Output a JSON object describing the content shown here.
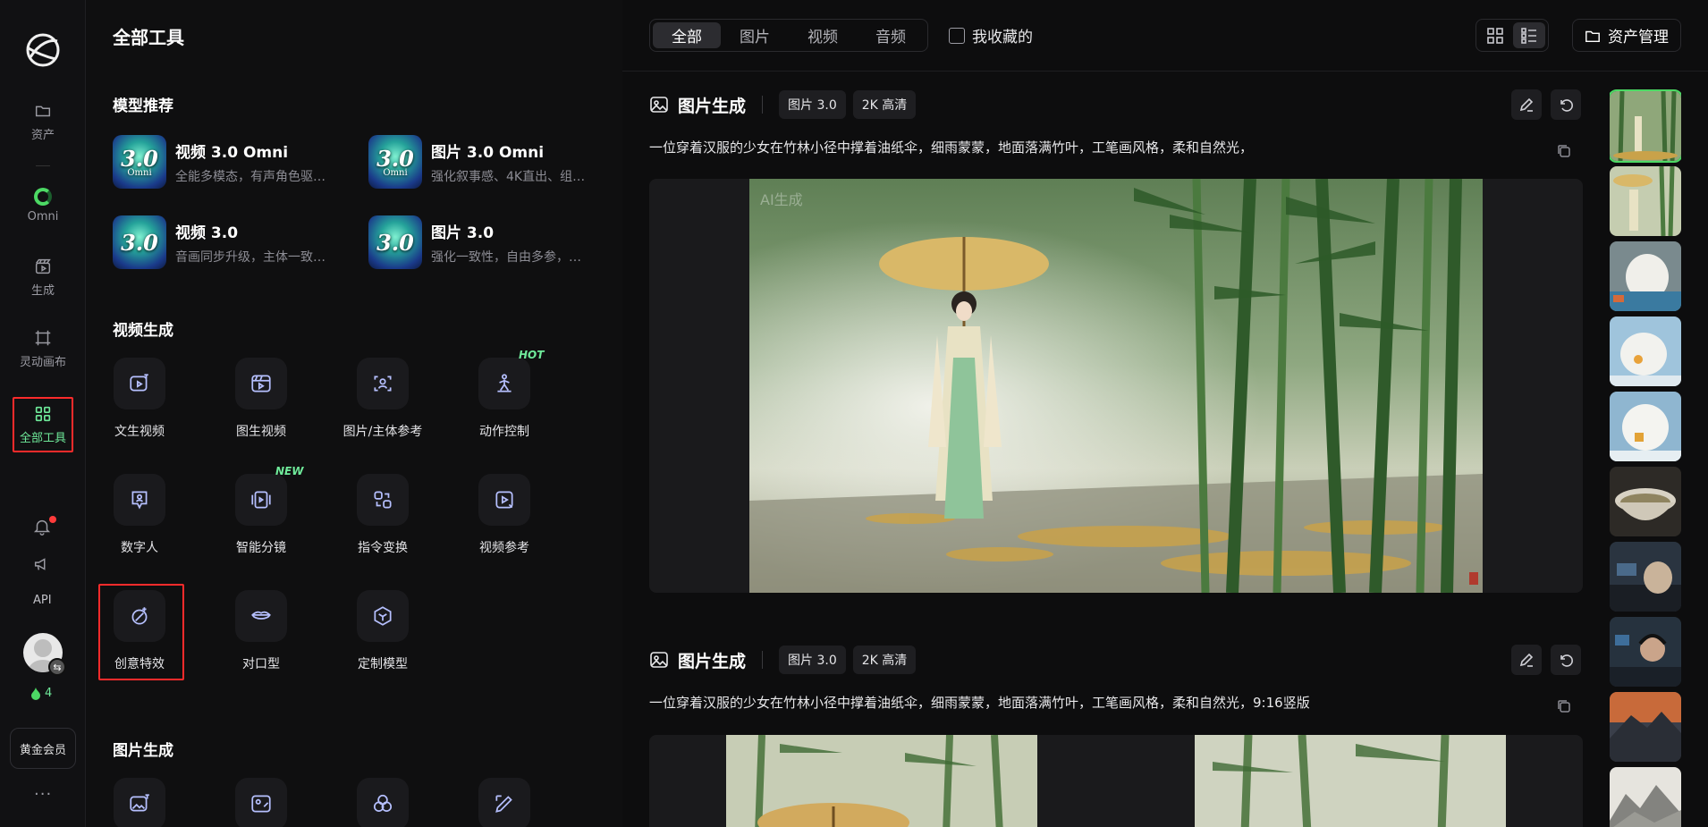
{
  "rail": {
    "items": [
      {
        "label": "资产",
        "icon": "folder-icon"
      },
      {
        "label": "Omni",
        "icon": "omni-icon"
      },
      {
        "label": "生成",
        "icon": "clapper-icon"
      },
      {
        "label": "灵动画布",
        "icon": "canvas-icon"
      },
      {
        "label": "全部工具",
        "icon": "grid-icon"
      }
    ],
    "api_label": "API",
    "credits": "4",
    "member_label": "黄金会员",
    "more_label": "···"
  },
  "tools_panel": {
    "title": "全部工具",
    "models_section": "模型推荐",
    "models": [
      {
        "name": "视频 3.0 Omni",
        "desc": "全能多模态，有声角色驱…",
        "badge": "3.0",
        "sub": "Omni"
      },
      {
        "name": "图片 3.0 Omni",
        "desc": "强化叙事感、4K直出、组…",
        "badge": "3.0",
        "sub": "Omni"
      },
      {
        "name": "视频 3.0",
        "desc": "音画同步升级，主体一致…",
        "badge": "3.0",
        "sub": ""
      },
      {
        "name": "图片 3.0",
        "desc": "强化一致性，自由多参，…",
        "badge": "3.0",
        "sub": ""
      }
    ],
    "video_section": "视频生成",
    "video_tools": [
      {
        "label": "文生视频",
        "icon": "text-to-video-icon",
        "tag": ""
      },
      {
        "label": "图生视频",
        "icon": "image-to-video-icon",
        "tag": ""
      },
      {
        "label": "图片/主体参考",
        "icon": "subject-reference-icon",
        "tag": ""
      },
      {
        "label": "动作控制",
        "icon": "motion-control-icon",
        "tag": "HOT"
      },
      {
        "label": "数字人",
        "icon": "digital-human-icon",
        "tag": ""
      },
      {
        "label": "智能分镜",
        "icon": "storyboard-icon",
        "tag": "NEW"
      },
      {
        "label": "指令变换",
        "icon": "instruction-transform-icon",
        "tag": ""
      },
      {
        "label": "视频参考",
        "icon": "video-reference-icon",
        "tag": ""
      },
      {
        "label": "创意特效",
        "icon": "creative-effects-icon",
        "tag": ""
      },
      {
        "label": "对口型",
        "icon": "lip-sync-icon",
        "tag": ""
      },
      {
        "label": "定制模型",
        "icon": "custom-model-icon",
        "tag": ""
      }
    ],
    "image_section": "图片生成"
  },
  "topbar": {
    "tabs": [
      "全部",
      "图片",
      "视频",
      "音频"
    ],
    "active_tab": "全部",
    "favorites_label": "我收藏的",
    "asset_button": "资产管理"
  },
  "cards": [
    {
      "title": "图片生成",
      "model_chip": "图片 3.0",
      "quality_chip": "2K 高清",
      "prompt": "一位穿着汉服的少女在竹林小径中撑着油纸伞，细雨蒙蒙，地面落满竹叶，工笔画风格，柔和自然光，",
      "watermark": "AI生成"
    },
    {
      "title": "图片生成",
      "model_chip": "图片 3.0",
      "quality_chip": "2K 高清",
      "prompt": "一位穿着汉服的少女在竹林小径中撑着油纸伞，细雨蒙蒙，地面落满竹叶，工笔画风格，柔和自然光，9:16竖版",
      "watermark": ""
    }
  ],
  "thumbnails": [
    "bamboo-girl",
    "bamboo-girl-umbrella",
    "polar-bear-pool",
    "polar-bear-snow",
    "polar-bear-fish",
    "tea-bowl",
    "cat-keyboard",
    "boy-headphones",
    "mountain-sunset",
    "ink-mountains"
  ],
  "colors": {
    "accent": "#4cd964",
    "highlight": "#ff2b2b",
    "icon_tint": "#b6c0ff"
  }
}
